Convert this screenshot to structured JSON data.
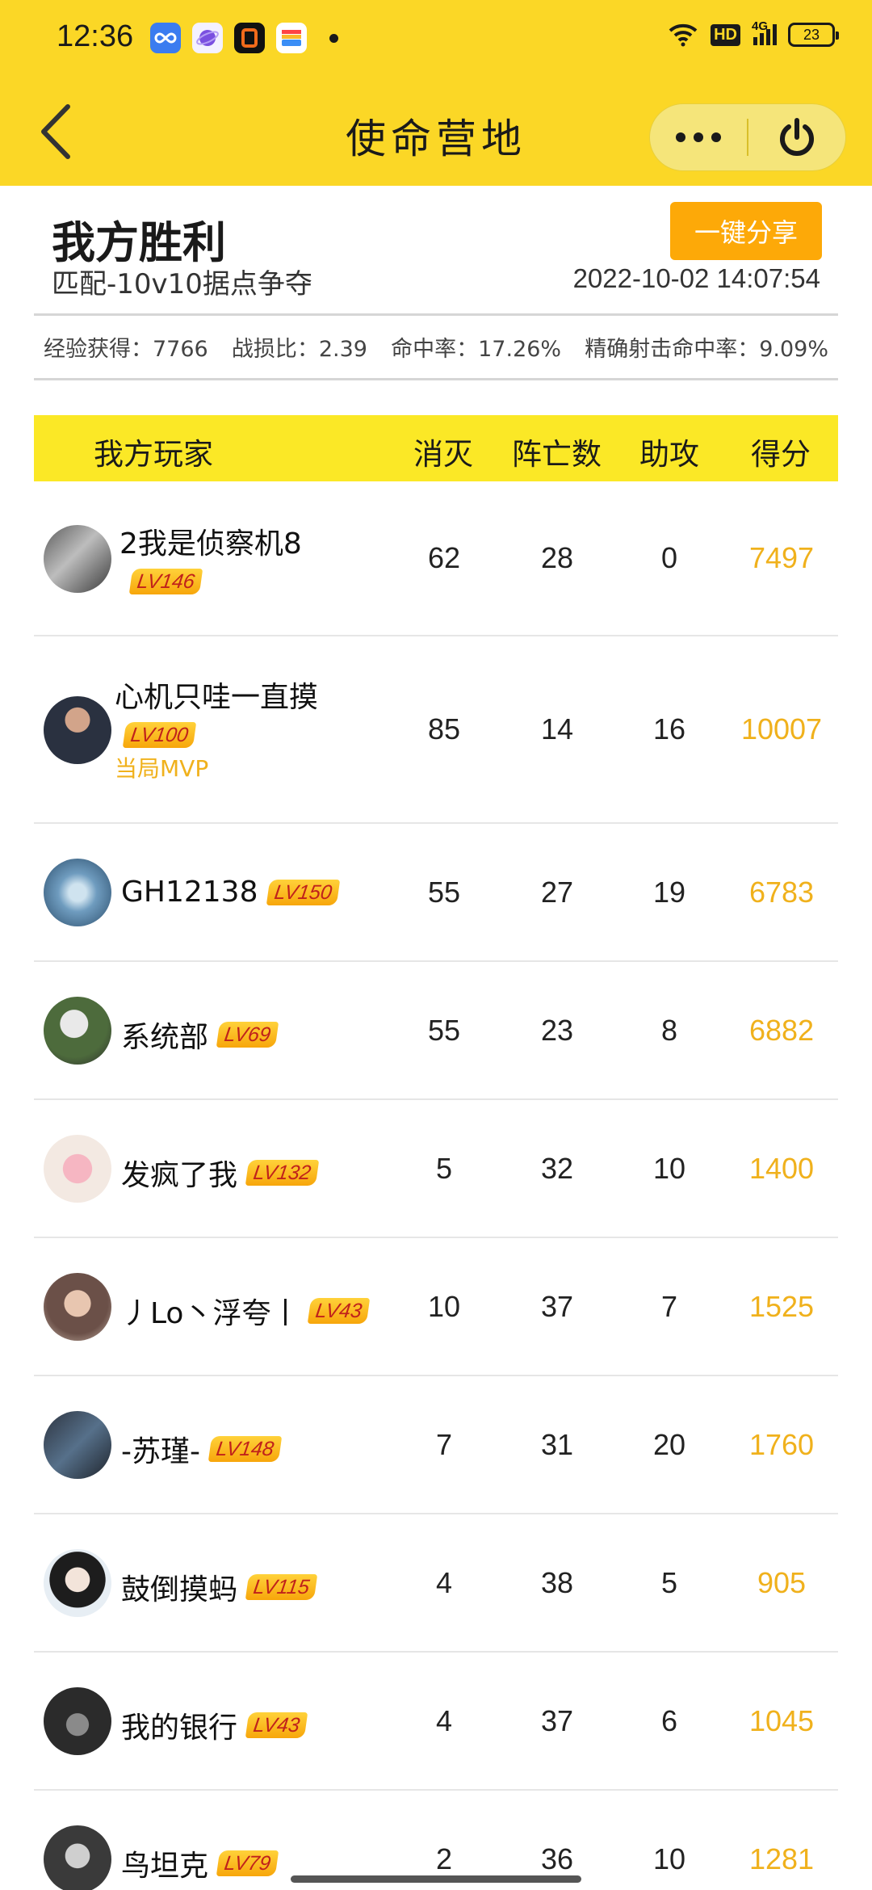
{
  "status_bar": {
    "time": "12:36",
    "network": "4G",
    "hd": "HD",
    "battery": "23"
  },
  "header": {
    "title": "使命营地"
  },
  "summary": {
    "result": "我方胜利",
    "mode": "匹配-10v10据点争夺",
    "share_label": "一键分享",
    "datetime": "2022-10-02 14:07:54",
    "stats": [
      "经验获得：7766",
      "战损比：2.39",
      "命中率：17.26%",
      "精确射击命中率：9.09%"
    ]
  },
  "table": {
    "headers": [
      "我方玩家",
      "消灭",
      "阵亡数",
      "助攻",
      "得分"
    ],
    "rows": [
      {
        "name": "2我是侦察机8",
        "level": "LV146",
        "kills": "62",
        "deaths": "28",
        "assists": "0",
        "score": "7497",
        "mvp": ""
      },
      {
        "name": "心机只哇一直摸",
        "level": "LV100",
        "kills": "85",
        "deaths": "14",
        "assists": "16",
        "score": "10007",
        "mvp": "当局MVP"
      },
      {
        "name": "GH12138",
        "level": "LV150",
        "kills": "55",
        "deaths": "27",
        "assists": "19",
        "score": "6783",
        "mvp": ""
      },
      {
        "name": "系统部",
        "level": "LV69",
        "kills": "55",
        "deaths": "23",
        "assists": "8",
        "score": "6882",
        "mvp": ""
      },
      {
        "name": "发疯了我",
        "level": "LV132",
        "kills": "5",
        "deaths": "32",
        "assists": "10",
        "score": "1400",
        "mvp": ""
      },
      {
        "name": "丿Lo丶浮夸丨",
        "level": "LV43",
        "kills": "10",
        "deaths": "37",
        "assists": "7",
        "score": "1525",
        "mvp": ""
      },
      {
        "name": "-苏瑾-",
        "level": "LV148",
        "kills": "7",
        "deaths": "31",
        "assists": "20",
        "score": "1760",
        "mvp": ""
      },
      {
        "name": "鼓倒摸蚂",
        "level": "LV115",
        "kills": "4",
        "deaths": "38",
        "assists": "5",
        "score": "905",
        "mvp": ""
      },
      {
        "name": "我的银行",
        "level": "LV43",
        "kills": "4",
        "deaths": "37",
        "assists": "6",
        "score": "1045",
        "mvp": ""
      },
      {
        "name": "鸟坦克",
        "level": "LV79",
        "kills": "2",
        "deaths": "36",
        "assists": "10",
        "score": "1281",
        "mvp": ""
      }
    ]
  }
}
